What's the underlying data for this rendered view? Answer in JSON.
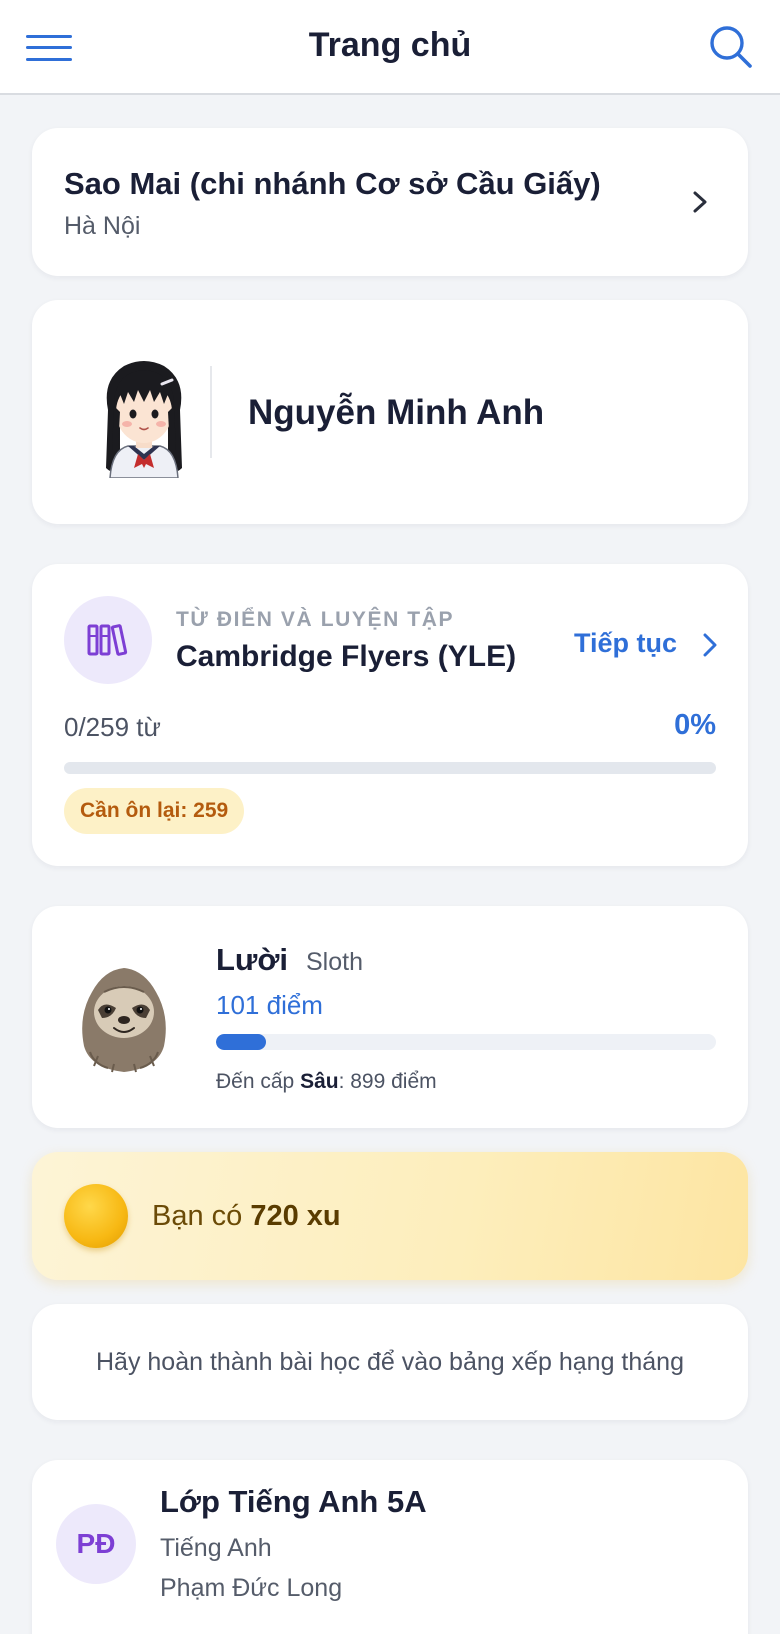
{
  "header": {
    "title": "Trang chủ",
    "menu_icon": "hamburger-menu-icon",
    "search_icon": "search-icon"
  },
  "branch": {
    "name": "Sao Mai (chi nhánh Cơ sở Cầu Giấy)",
    "city": "Hà Nội"
  },
  "student": {
    "name": "Nguyễn Minh Anh",
    "avatar": "student-avatar-girl"
  },
  "dictionary": {
    "kicker": "TỪ ĐIỂN VÀ LUYỆN TẬP",
    "title": "Cambridge Flyers (YLE)",
    "continue_label": "Tiếp tục",
    "progress_text": "0/259 từ",
    "percent_text": "0%",
    "progress_fraction": 0,
    "review_badge": "Cần ôn lại: 259",
    "icon": "books-icon"
  },
  "level": {
    "name": "Lười",
    "name_en": "Sloth",
    "points_text": "101 điểm",
    "progress_fraction": 0.1,
    "next_prefix": "Đến cấp ",
    "next_level": "Sâu",
    "next_suffix": ": 899 điểm",
    "image": "sloth-avatar"
  },
  "coins": {
    "prefix": "Bạn có ",
    "amount": "720 xu",
    "icon": "coin-icon"
  },
  "leaderboard": {
    "message": "Hãy hoàn thành bài học để vào bảng xếp hạng tháng"
  },
  "class": {
    "initials": "PĐ",
    "name": "Lớp Tiếng Anh 5A",
    "subject": "Tiếng Anh",
    "teacher": "Phạm Đức Long"
  },
  "colors": {
    "accent": "#2f6fd8",
    "background": "#f2f4f7",
    "badge_bg": "#fdf1c7",
    "badge_text": "#b45b0e",
    "purple": "#7d3fd4"
  }
}
